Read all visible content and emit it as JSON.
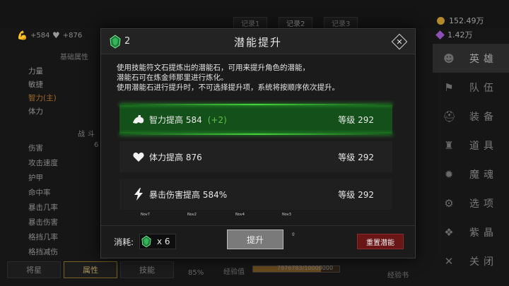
{
  "header": {
    "records": [
      "记录1",
      "记录2",
      "记录3"
    ],
    "stats": [
      {
        "icon": "arm-icon",
        "value": "+584"
      },
      {
        "icon": "heart-icon",
        "value": "+876"
      }
    ],
    "currency": [
      {
        "icon": "gold-coin-icon",
        "value": "152.49万"
      },
      {
        "icon": "purple-gem-icon",
        "value": "1.42万"
      }
    ]
  },
  "sidebar": {
    "items": [
      {
        "glyph": "☻",
        "label": "英雄"
      },
      {
        "glyph": "⚑",
        "label": "队伍"
      },
      {
        "glyph": "⛑",
        "label": "装备"
      },
      {
        "glyph": "♜",
        "label": "道具"
      },
      {
        "glyph": "✹",
        "label": "魔魂"
      },
      {
        "glyph": "⚙",
        "label": "选项"
      },
      {
        "glyph": "❖",
        "label": "紫晶"
      },
      {
        "glyph": "✕",
        "label": "关闭"
      }
    ]
  },
  "left": {
    "base_title": "基础属性",
    "attrs": [
      "力量",
      "敏捷",
      "智力(主)",
      "体力"
    ],
    "combat_title": "战斗",
    "combat_num": "6",
    "combat": [
      "伤害",
      "攻击速度",
      "护甲",
      "命中率",
      "暴击几率",
      "暴击伤害",
      "格挡几率",
      "格挡减伤"
    ]
  },
  "bottom": {
    "tabs": [
      "将星",
      "属性",
      "技能"
    ],
    "exp_label": "经验值",
    "exp_text": "7876783/10000000",
    "exp_fraction": 0.79,
    "percent": "85%",
    "book": "经验书"
  },
  "modal": {
    "title": "潜能提升",
    "stone_count": "2",
    "description": [
      "使用技能符文石提炼出的潜能石，可用来提升角色的潜能，",
      "潜能石可在炼金师那里进行炼化。",
      "使用潜能石进行提升时，不可选择提升项，系统将按顺序依次提升。"
    ],
    "rows": [
      {
        "icon": "arm-icon",
        "label": "智力提高 584",
        "bonus": "(+2)",
        "level": "等级 292"
      },
      {
        "icon": "heart-icon",
        "label": "体力提高 876",
        "bonus": "",
        "level": "等级 292"
      },
      {
        "icon": "lightning-icon",
        "label": "暴击伤害提高 584%",
        "bonus": "",
        "level": "等级 292"
      }
    ],
    "tiny_labels": [
      "Nov7",
      "Nov2",
      "Nov4",
      "Nov3"
    ],
    "footer": {
      "cost_label": "消耗:",
      "cost_value": "x 6",
      "upgrade_label": "提升",
      "reset_label": "重置潜能"
    }
  },
  "colors": {
    "selected_row": "#14501a",
    "glow": "#45d43a",
    "bonus": "#5ac34a",
    "reset_button": "#6a1616"
  }
}
